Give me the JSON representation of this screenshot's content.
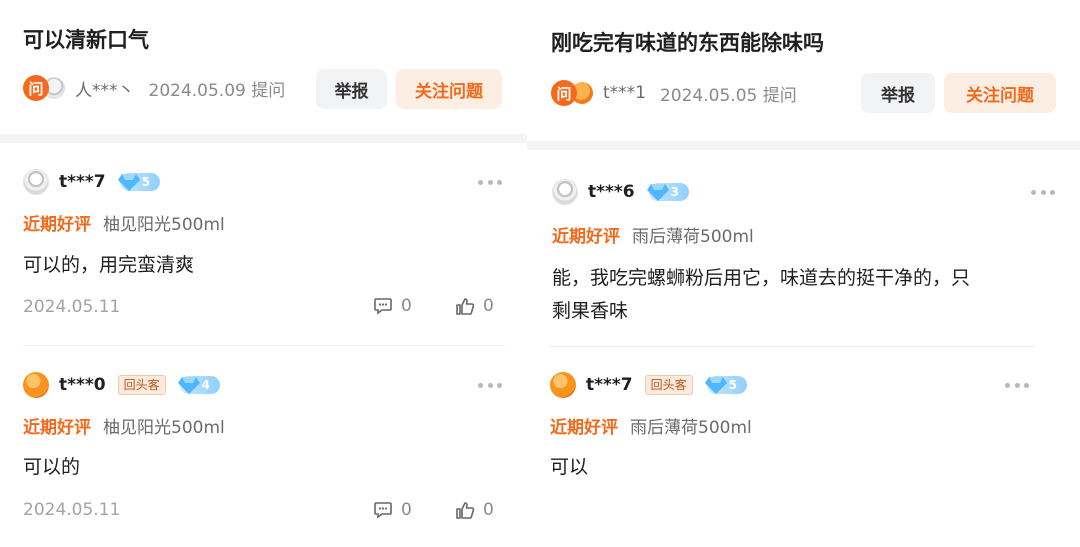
{
  "left": {
    "question": {
      "badge": "问",
      "title": "可以清新口气",
      "asker": "人***丶",
      "date_label": "2024.05.09 提问",
      "report_label": "举报",
      "follow_label": "关注问题"
    },
    "answers": [
      {
        "user": "t***7",
        "avatar": "robot-avatar",
        "repeat_tag": "",
        "level": "5",
        "tag": "近期好评",
        "spec": "柚见阳光500ml",
        "text": "可以的，用完蛮清爽",
        "date": "2024.05.11",
        "comments": "0",
        "likes": "0"
      },
      {
        "user": "t***0",
        "avatar": "dino-avatar",
        "repeat_tag": "回头客",
        "level": "4",
        "tag": "近期好评",
        "spec": "柚见阳光500ml",
        "text": "可以的",
        "date": "2024.05.11",
        "comments": "0",
        "likes": "0"
      }
    ]
  },
  "right": {
    "question": {
      "badge": "问",
      "title": "刚吃完有味道的东西能除味吗",
      "asker": "t***1",
      "date_label": "2024.05.05 提问",
      "report_label": "举报",
      "follow_label": "关注问题"
    },
    "answers": [
      {
        "user": "t***6",
        "avatar": "robot-avatar",
        "repeat_tag": "",
        "level": "3",
        "tag": "近期好评",
        "spec": "雨后薄荷500ml",
        "text_line1": "能，我吃完螺蛳粉后用它，味道去的挺干净的，只",
        "text_line2": "剩果香味"
      },
      {
        "user": "t***7",
        "avatar": "dino-avatar",
        "repeat_tag": "回头客",
        "level": "5",
        "tag": "近期好评",
        "spec": "雨后薄荷500ml",
        "text": "可以"
      }
    ]
  },
  "colors": {
    "accent": "#f26a1b",
    "follow_bg": "#fdeee4",
    "level_gradient": [
      "#c7e7ff",
      "#8fd0ff"
    ],
    "divider": "#eeeeee",
    "gap": "#f3f4f6"
  }
}
